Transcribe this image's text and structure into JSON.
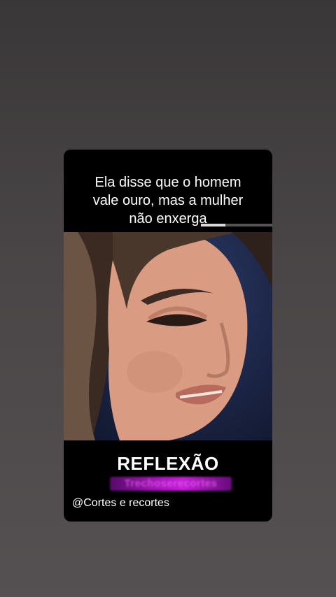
{
  "video": {
    "caption_lines": [
      "Ela disse que o homem",
      "vale ouro, mas a mulher",
      "não enxerga"
    ],
    "progress_fraction": 0.34,
    "image_description": "close-up of woman speaking",
    "title": "REFLEXÃO",
    "watermark": "Trechoserecortes",
    "handle": "@Cortes e recortes"
  },
  "colors": {
    "card": "#000000",
    "watermark": "#c51cd9"
  }
}
